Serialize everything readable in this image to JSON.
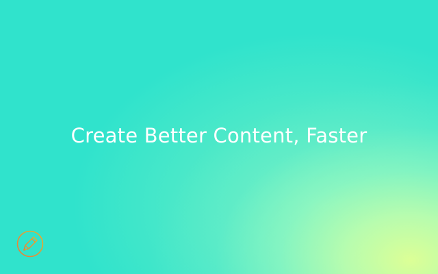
{
  "hero": {
    "headline": "Create Better Content, Faster"
  },
  "logo": {
    "icon": "pencil-circle-icon"
  },
  "colors": {
    "background_teal": "#30e3cc",
    "background_glow": "#dcff96",
    "headline_text": "#ffffff",
    "logo_orange": "#e8793a",
    "logo_gold": "#e6b32e"
  }
}
